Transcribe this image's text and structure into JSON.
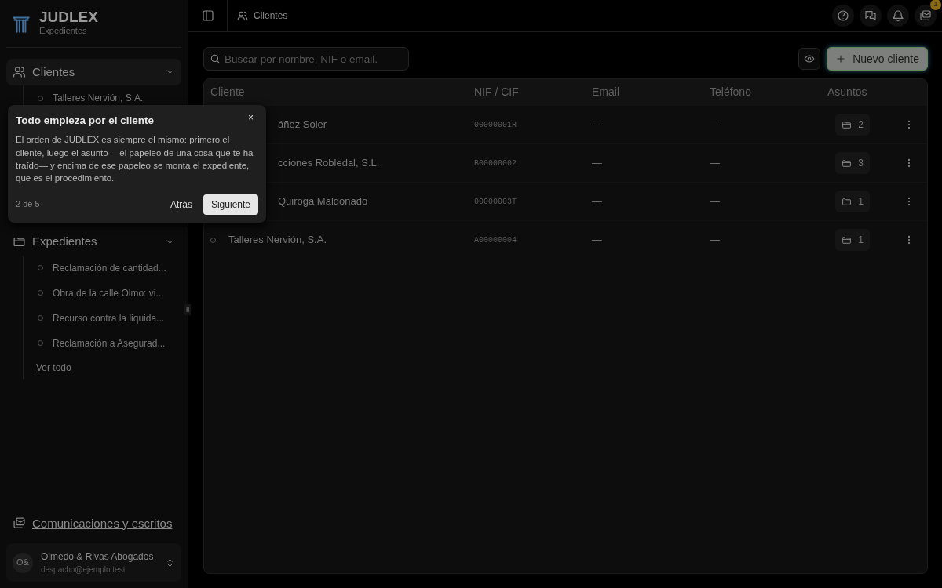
{
  "brand": {
    "name": "JUDLEX",
    "subtitle": "Expedientes"
  },
  "sidebar": {
    "sections": [
      {
        "kind": "clients",
        "label": "Clientes",
        "expanded": true,
        "items": [
          {
            "label": "Talleres Nervión, S.A."
          }
        ]
      },
      {
        "kind": "files",
        "label": "Expedientes",
        "expanded": true,
        "items": [
          {
            "label": "Reclamación de cantidad..."
          },
          {
            "label": "Obra de la calle Olmo: vi..."
          },
          {
            "label": "Recurso contra la liquida..."
          },
          {
            "label": "Reclamación a Asegurad..."
          }
        ],
        "footer_link": "Ver todo"
      }
    ],
    "bottom_link": "Comunicaciones y escritos",
    "account": {
      "initials": "O&",
      "name": "Olmedo & Rivas Abogados",
      "email": "despacho@ejemplo.test"
    }
  },
  "topbar": {
    "breadcrumb": "Clientes",
    "inbox_badge": "1"
  },
  "toolbar": {
    "search": {
      "placeholder": "Buscar por nombre, NIF o email."
    },
    "new_button": "Nuevo cliente"
  },
  "table": {
    "columns": [
      "Cliente",
      "NIF / CIF",
      "Email",
      "Teléfono",
      "Asuntos"
    ],
    "rows": [
      {
        "name": "áñez Soler",
        "covered": true,
        "nif": "00000001R",
        "email": "—",
        "phone": "—",
        "matters": "2"
      },
      {
        "name": "cciones Robledal, S.L.",
        "covered": true,
        "nif": "B00000002",
        "email": "—",
        "phone": "—",
        "matters": "3"
      },
      {
        "name": "Quiroga Maldonado",
        "covered": true,
        "nif": "00000003T",
        "email": "—",
        "phone": "—",
        "matters": "1"
      },
      {
        "name": "Talleres Nervión, S.A.",
        "covered": false,
        "nif": "A00000004",
        "email": "—",
        "phone": "—",
        "matters": "1"
      }
    ]
  },
  "tour": {
    "title": "Todo empieza por el cliente",
    "close": "×",
    "body": "El orden de JUDLEX es siempre el mismo: primero el cliente, luego el asunto —el papeleo de una cosa que te ha traído— y encima de ese papeleo se monta el expediente, que es el procedimiento.",
    "step": "2 de 5",
    "back": "Atrás",
    "next": "Siguiente"
  }
}
